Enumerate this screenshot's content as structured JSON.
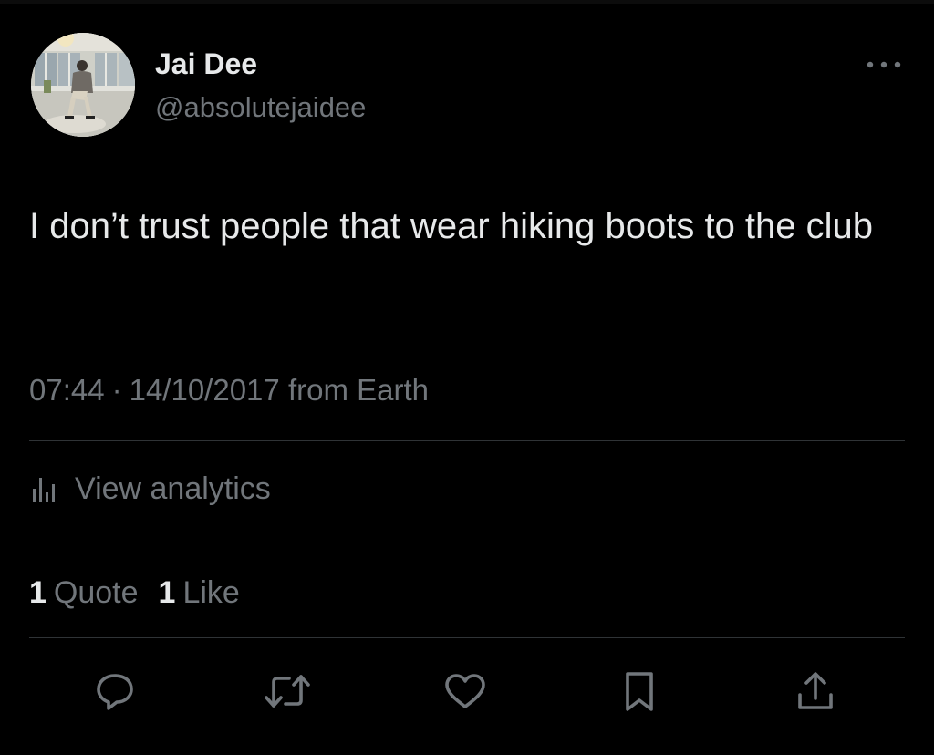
{
  "author": {
    "name": "Jai Dee",
    "handle": "@absolutejaidee"
  },
  "tweet": {
    "text": "I don’t trust people that wear hiking boots to the club",
    "time": "07:44",
    "separator": "·",
    "date": "14/10/2017",
    "source": "from Earth"
  },
  "analytics": {
    "label": "View analytics",
    "icon": "bar-chart-icon"
  },
  "stats": {
    "quotes_count": "1",
    "quotes_label": "Quote",
    "likes_count": "1",
    "likes_label": "Like"
  },
  "actions": [
    {
      "name": "reply",
      "icon": "reply-icon"
    },
    {
      "name": "retweet",
      "icon": "retweet-icon"
    },
    {
      "name": "like",
      "icon": "heart-icon"
    },
    {
      "name": "bookmark",
      "icon": "bookmark-icon"
    },
    {
      "name": "share",
      "icon": "share-icon"
    }
  ],
  "colors": {
    "background": "#000000",
    "primary_text": "#e7e9ea",
    "secondary_text": "#71767b",
    "divider": "#2f3336"
  }
}
